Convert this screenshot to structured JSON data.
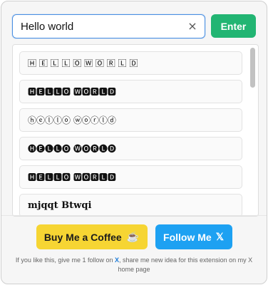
{
  "search": {
    "value": "Hello world",
    "clear_label": "×",
    "enter_label": "Enter"
  },
  "results": [
    "🄷 🄴 🄻 🄻 🄾  🅆 🄾 🅁 🄻 🄳",
    "🅷🅴🅻🅻🅾 🆆🅾🆁🅻🅳",
    "ⓗⓔⓛⓛⓞ ⓦⓞⓡⓛⓓ",
    "🅗🅔🅛🅛🅞 🅦🅞🅡🅛🅓",
    "🅷🅴🅻🅻🅾 🆆🅾🆁🅻🅳",
    "mjqqt Btwqi"
  ],
  "footer": {
    "coffee_label": "Buy Me a Coffee",
    "coffee_icon": "☕",
    "follow_label": "Follow Me",
    "follow_icon": "𝕏",
    "note_prefix": "If you like this, give me 1 follow on ",
    "note_link": "X",
    "note_suffix": ", share me new idea for this extension on my X home page"
  },
  "colors": {
    "enter_button": "#22b573",
    "coffee_button": "#f6d533",
    "follow_button": "#1da1f2",
    "search_border": "#4a90e2"
  }
}
